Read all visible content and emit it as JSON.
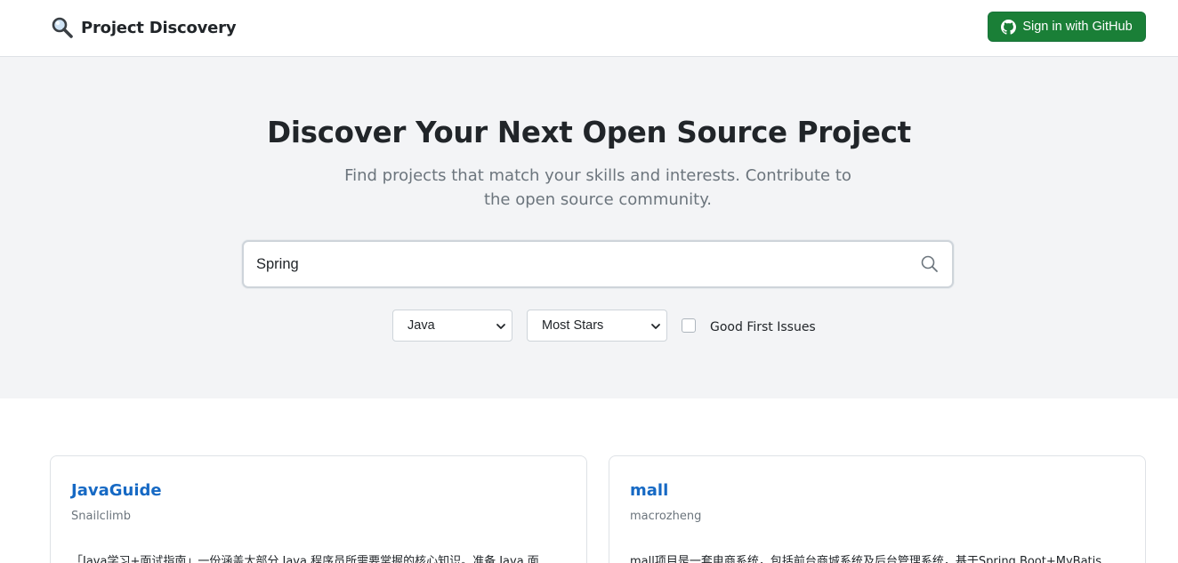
{
  "navbar": {
    "brand_name": "Project Discovery",
    "brand_icon": "magnifying-glass-icon",
    "signin_label": "Sign in with GitHub",
    "signin_icon": "github-icon",
    "signin_color": "#1a7f37"
  },
  "hero": {
    "title": "Discover Your Next Open Source Project",
    "subtitle": "Find projects that match your skills and interests. Contribute to the open source community."
  },
  "search": {
    "value": "Spring",
    "icon": "search-icon"
  },
  "filters": {
    "language": "Java",
    "sort": "Most Stars",
    "good_first_issues_label": "Good First Issues",
    "good_first_issues_checked": false
  },
  "projects": [
    {
      "name": "JavaGuide",
      "owner": "Snailclimb",
      "description": "「Java学习+面试指南」一份涵盖大部分 Java 程序员所需要掌握的核心知识。准备 Java 面"
    },
    {
      "name": "mall",
      "owner": "macrozheng",
      "description": "mall项目是一套电商系统，包括前台商城系统及后台管理系统，基于Spring Boot+MyBatis"
    }
  ]
}
